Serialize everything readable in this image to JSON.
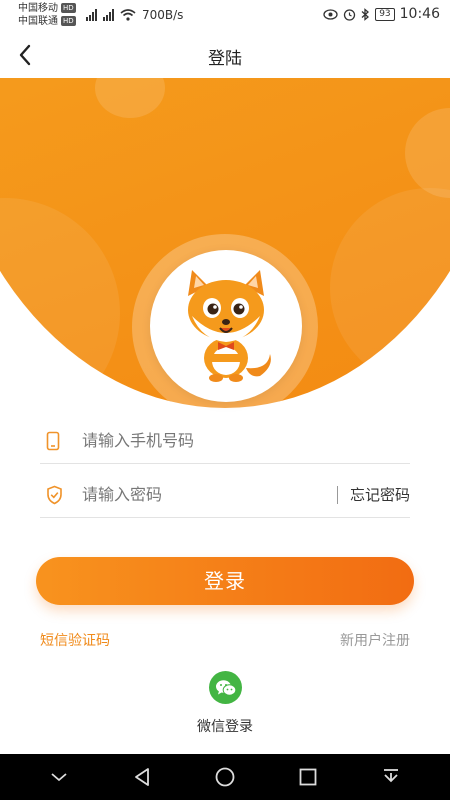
{
  "status_bar": {
    "carrier1": "中国移动",
    "carrier2": "中国联通",
    "hd": "HD",
    "net": "4G",
    "speed": "700B/s",
    "battery": "93",
    "time": "10:46"
  },
  "header": {
    "title": "登陆"
  },
  "form": {
    "phone_placeholder": "请输入手机号码",
    "password_placeholder": "请输入密码",
    "forgot_label": "忘记密码",
    "login_label": "登录",
    "sms_label": "短信验证码",
    "register_label": "新用户注册"
  },
  "wechat": {
    "label": "微信登录"
  },
  "colors": {
    "accent": "#f7941d",
    "accent_dark": "#f26c12",
    "wechat": "#43b543"
  }
}
